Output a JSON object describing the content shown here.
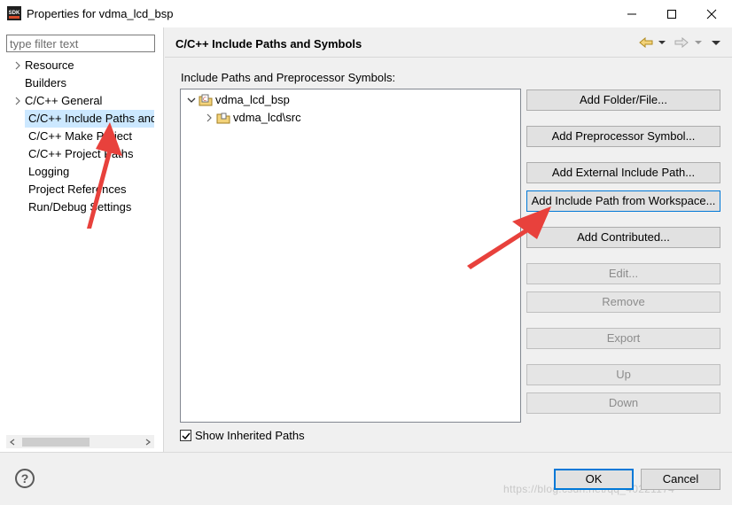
{
  "window": {
    "app_icon_text": "SDK",
    "title": "Properties for vdma_lcd_bsp"
  },
  "sidebar": {
    "filter_placeholder": "type filter text",
    "items": [
      {
        "label": "Resource",
        "expandable": true
      },
      {
        "label": "Builders",
        "expandable": false
      },
      {
        "label": "C/C++ General",
        "expandable": true
      },
      {
        "label": "C/C++ Include Paths and Symbols",
        "expandable": false,
        "selected": true
      },
      {
        "label": "C/C++ Make Project",
        "expandable": false
      },
      {
        "label": "C/C++ Project Paths",
        "expandable": false
      },
      {
        "label": "Logging",
        "expandable": false
      },
      {
        "label": "Project References",
        "expandable": false
      },
      {
        "label": "Run/Debug Settings",
        "expandable": false
      }
    ]
  },
  "page": {
    "title": "C/C++ Include Paths and Symbols",
    "section_label": "Include Paths and Preprocessor Symbols:",
    "tree": [
      {
        "label": "vdma_lcd_bsp",
        "expanded": true
      },
      {
        "label": "vdma_lcd\\src",
        "expanded": false
      }
    ],
    "buttons": {
      "add_folder": "Add Folder/File...",
      "add_symbol": "Add Preprocessor Symbol...",
      "add_external": "Add External Include Path...",
      "add_workspace": "Add Include Path from Workspace...",
      "add_contributed": "Add Contributed...",
      "edit": "Edit...",
      "remove": "Remove",
      "export": "Export",
      "up": "Up",
      "down": "Down"
    },
    "show_inherited_label": "Show Inherited Paths",
    "show_inherited_checked": true
  },
  "footer": {
    "help": "?",
    "ok": "OK",
    "cancel": "Cancel",
    "watermark": "https://blog.csdn.net/qq_40221174"
  },
  "colors": {
    "selection": "#cce8ff",
    "accent": "#0078d7",
    "annotation_arrow": "#e8413c"
  }
}
